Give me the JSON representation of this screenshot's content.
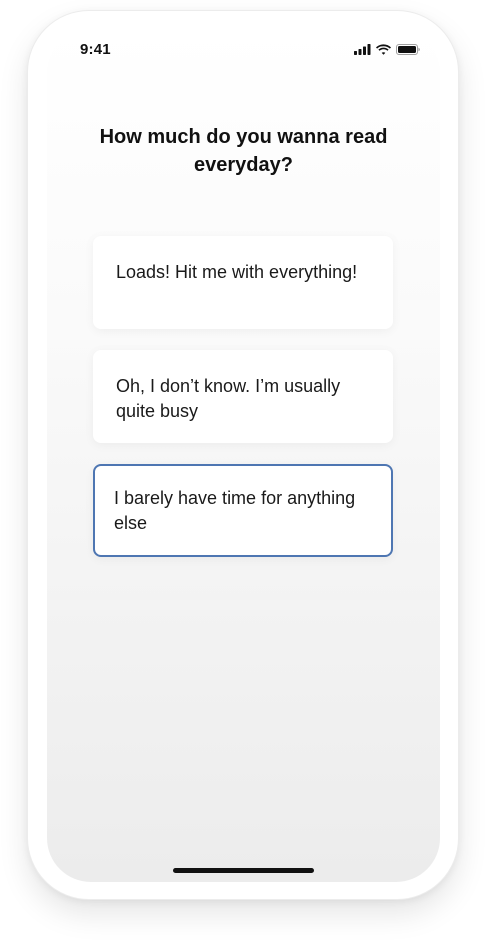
{
  "status_bar": {
    "time": "9:41",
    "icons": [
      "cellular-signal-icon",
      "wifi-icon",
      "battery-icon"
    ]
  },
  "question": {
    "title": "How much do you wanna read everyday?"
  },
  "options": [
    {
      "label": "Loads! Hit me with everything!",
      "selected": false
    },
    {
      "label": "Oh, I don’t know. I’m usually quite busy",
      "selected": false
    },
    {
      "label": "I barely have time for anything else",
      "selected": true
    }
  ],
  "colors": {
    "selected_border": "#4e76b2",
    "text": "#111111",
    "card_background": "#ffffff"
  }
}
